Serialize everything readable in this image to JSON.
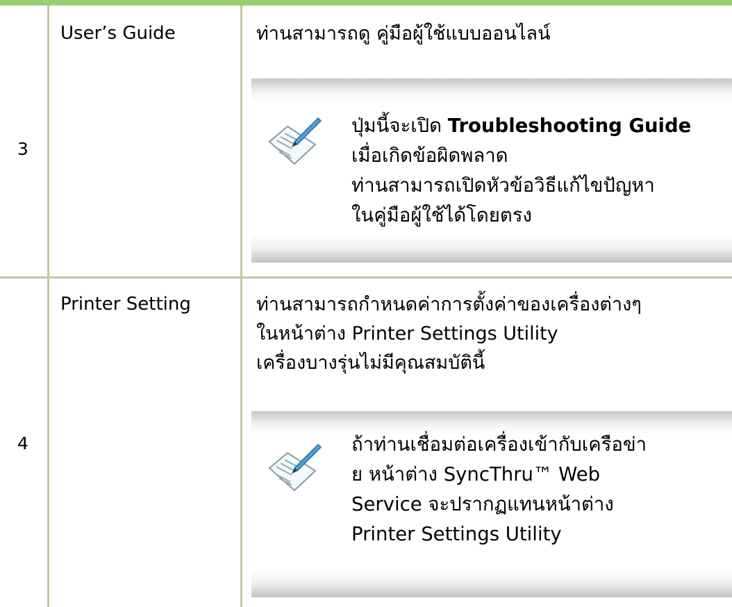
{
  "rows": [
    {
      "number": "3",
      "feature": "User’s Guide",
      "description": [
        "ท่านสามารถดู คู่มือผู้ใช้แบบออนไลน์"
      ],
      "note_icon": "note-pencil-icon",
      "note_lines": [
        {
          "pre": "ปุ่มนี้จะเปิด ",
          "bold": "Troubleshooting Guide"
        },
        {
          "text": "เมื่อเกิดข้อผิดพลาด"
        },
        {
          "text": "ท่านสามารถเปิดหัวข้อวิธีแก้ไขปัญหา"
        },
        {
          "text": "ในคู่มือผู้ใช้ได้โดยตรง"
        }
      ]
    },
    {
      "number": "4",
      "feature": "Printer Setting",
      "description": [
        "ท่านสามารถกำหนดค่าการตั้งค่าของเครื่องต่างๆ",
        "ในหน้าต่าง Printer Settings Utility",
        "เครื่องบางรุ่นไม่มีคุณสมบัตินี้"
      ],
      "note_icon": "note-pencil-icon",
      "note_lines": [
        "ถ้าท่านเชื่อมต่อเครื่องเข้ากับเครือข่า",
        "ย หน้าต่าง SyncThru™ Web",
        "Service จะปรากฏแทนหน้าต่าง",
        "Printer Settings Utility"
      ]
    }
  ],
  "colors": {
    "header_bar": "#9bce70",
    "grid_line": "#c7c7a2"
  }
}
